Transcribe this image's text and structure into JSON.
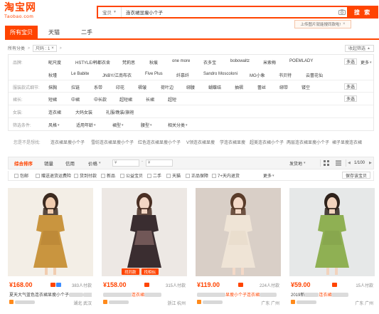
{
  "logo": {
    "cn": "淘宝网",
    "en": "Taobao.com"
  },
  "search": {
    "category": "宝贝",
    "query": "连衣裙显瘦小个子",
    "button": "搜 索",
    "image_search_tip": "上传图片就能搜同款啦!"
  },
  "tabs": [
    {
      "label": "所有宝贝",
      "active": true
    },
    {
      "label": "天猫",
      "active": false
    },
    {
      "label": "二手",
      "active": false
    }
  ],
  "breadcrumb": {
    "all_categories": "所有分类",
    "size_filter": "尺码 : 1",
    "collapse": "收起筛选"
  },
  "filters": {
    "brand": {
      "label": "品牌:",
      "row1": [
        "昵尺度",
        "HSTYLE/韩都衣舍",
        "梵莉思",
        "秋痕",
        "one more",
        "衣多宝",
        "bobowaltz",
        "米索梅",
        "POEMLADY"
      ],
      "row2": [
        "秋瑾",
        "Le Babite",
        "JNBY/江南布衣",
        "Five Plus",
        "纤慕纤",
        "Sandro Moscoloni",
        "MG小象",
        "书贝特",
        "云蕾花仙"
      ],
      "multi": "多选",
      "more": "更多"
    },
    "style": {
      "label": "服装款式细节:",
      "options": [
        "抹胸",
        "拉链",
        "系带",
        "印花",
        "褶皱",
        "荷叶边",
        "绑腰",
        "蝴蝶结",
        "抽褶",
        "蕾丝",
        "绑带",
        "镂空"
      ],
      "multi": "多选"
    },
    "sleeve": {
      "label": "裙长:",
      "options": [
        "短裙",
        "中裙",
        "中长款",
        "超短裙",
        "长裙",
        "超短"
      ],
      "multi": "多选"
    },
    "women": {
      "label": "女装:",
      "options": [
        "连衣裙",
        "大码女装",
        "礼服/晚装/旗袍"
      ]
    },
    "conditions": {
      "label": "筛选条件:",
      "options": [
        "风格",
        "适用年龄",
        "裙型",
        "腰型",
        "相关分类"
      ]
    }
  },
  "related": {
    "label": "您是不是想找:",
    "keywords": [
      "连衣裙显瘦小个子",
      "雪纺连衣裙显瘦小个子",
      "红色连衣裙显瘦小个子",
      "V领连衣裙显瘦",
      "学连衣裙显瘦",
      "超美连衣裙小个子",
      "两层连衣裙显瘦小个子",
      "裙子显瘦连衣裙"
    ]
  },
  "sort": {
    "items": [
      "综合排序",
      "销量",
      "信用",
      "价格"
    ],
    "price_from_placeholder": "¥",
    "price_to_placeholder": "¥",
    "location": "发货地",
    "page": "1/100"
  },
  "checkboxes": [
    "包邮",
    "赠送退货运费险",
    "货到付款",
    "新品",
    "公益宝贝",
    "二手",
    "天猫",
    "正品保障",
    "7+天内退货"
  ],
  "more_label": "更多",
  "save_button": "保存该宝贝",
  "products": [
    {
      "price": "¥168.00",
      "sales": "383人付款",
      "title_plain": "夏天大气蓝色连衣裙显瘦小个子",
      "title_hl": "",
      "shop": "",
      "location": "湖北 武汉",
      "badges": [],
      "icons": [
        "#ff4400",
        "#3c8cff"
      ],
      "colors": {
        "bg": "#f3eee6",
        "dress": "#c9953f",
        "accent": "#a8762a",
        "skin": "#f1cdb0",
        "hair": "#3b2a20"
      }
    },
    {
      "price": "¥158.00",
      "sales": "315人付款",
      "title_plain": "",
      "title_hl": "连衣裙",
      "shop": "",
      "location": "浙江 杭州",
      "badges": [
        "找同款",
        "找相似"
      ],
      "icons": [
        "#ff4400"
      ],
      "colors": {
        "bg": "#ede8e4",
        "dress": "#3a2d30",
        "accent": "#d9a5a0",
        "skin": "#f3d6c4",
        "hair": "#4a2f24"
      }
    },
    {
      "price": "¥119.00",
      "sales": "224人付款",
      "title_plain": "",
      "title_hl": "显瘦小个子连衣裙",
      "shop": "",
      "location": "广东 广州",
      "badges": [],
      "icons": [
        "#ff4400"
      ],
      "colors": {
        "bg": "#d9cfc7",
        "dress": "#efe4d6",
        "accent": "#e2d3c0",
        "skin": "#f4d9c7",
        "hair": "#5a3c2a"
      }
    },
    {
      "price": "¥59.00",
      "sales": "15人付款",
      "title_plain": "2019新",
      "title_hl": "连衣裙",
      "shop": "",
      "location": "广东 广州",
      "badges": [],
      "icons": [
        "#ff4400"
      ],
      "colors": {
        "bg": "#e6e8e8",
        "dress": "#8fb053",
        "accent": "#7a9944",
        "skin": "#f2d3bd",
        "hair": "#2e221b"
      }
    }
  ]
}
